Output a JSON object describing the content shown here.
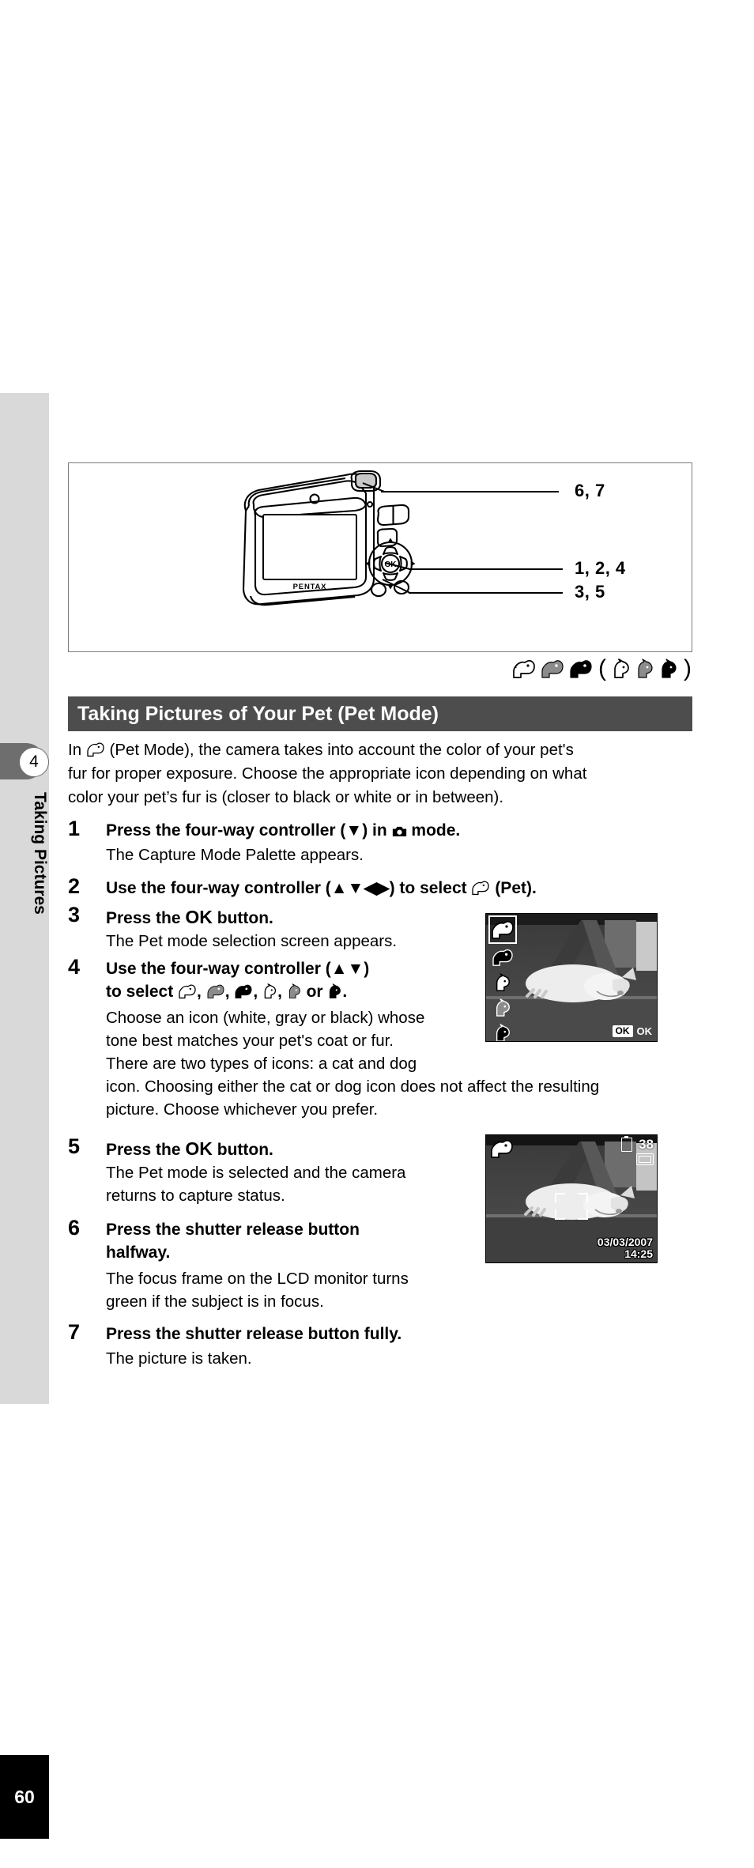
{
  "sidebar": {
    "chapter_number": "4",
    "chapter_label": "Taking Pictures",
    "page_number": "60"
  },
  "figure": {
    "camera_brand": "PENTAX",
    "callouts": [
      {
        "id": "shutter",
        "label": "6, 7"
      },
      {
        "id": "four-way-controller",
        "label": "1, 2, 4"
      },
      {
        "id": "ok-button",
        "label": "3, 5"
      }
    ]
  },
  "pet_icon_strip": {
    "dog_icons": [
      "dog-white-icon",
      "dog-gray-icon",
      "dog-black-icon"
    ],
    "open_paren": "(",
    "cat_icons": [
      "cat-white-icon",
      "cat-gray-icon",
      "cat-black-icon"
    ],
    "close_paren": ")"
  },
  "section": {
    "heading": "Taking Pictures of Your Pet (Pet Mode)"
  },
  "intro": {
    "line1_pre": "In",
    "line1_post": "(Pet Mode), the camera takes into account the color of your pet's",
    "line2": "fur for proper exposure. Choose the appropriate icon depending on what",
    "line3": "color your pet’s fur is (closer to black or white or in between)."
  },
  "steps": [
    {
      "number": "1",
      "title_a": "Press the four-way controller (",
      "title_arrow": "▼",
      "title_b": ") in",
      "title_c": "mode.",
      "body": [
        "The Capture Mode Palette appears."
      ]
    },
    {
      "number": "2",
      "title_a": "Use the four-way controller (",
      "title_arrows": "▲▼◀▶",
      "title_b": ") to select",
      "title_c": "(Pet).",
      "body": []
    },
    {
      "number": "3",
      "title_a": "Press the",
      "title_ok": "OK",
      "title_b": "button.",
      "body": [
        "The Pet mode selection screen appears."
      ]
    },
    {
      "number": "4",
      "title_a": "Use the four-way controller (",
      "title_arrows": "▲▼",
      "title_b": ")",
      "title_line2_a": "to select",
      "title_line2_or": "or",
      "title_line2_end": ".",
      "body": [
        "Choose an icon (white, gray or black) whose",
        "tone best matches your pet's coat or fur.",
        "There are two types of icons: a cat and dog",
        "icon. Choosing either the cat or dog icon does not affect the resulting",
        "picture. Choose whichever you prefer."
      ]
    },
    {
      "number": "5",
      "title_a": "Press the",
      "title_ok": "OK",
      "title_b": "button.",
      "body": [
        "The Pet mode is selected and the camera",
        "returns to capture status."
      ]
    },
    {
      "number": "6",
      "title_a": "Press the shutter release button",
      "title_line2": "halfway.",
      "body": [
        "The focus frame on the LCD monitor turns",
        "green if the subject is in focus."
      ]
    },
    {
      "number": "7",
      "title_a": "Press the shutter release button fully.",
      "body": [
        "The picture is taken."
      ]
    }
  ],
  "lcd_selection_screen": {
    "ok_solid": "OK",
    "ok_outline": "OK",
    "selector_items": [
      "dog-white-icon",
      "dog-black-icon",
      "cat-white-icon",
      "cat-gray-icon",
      "cat-black-icon"
    ]
  },
  "lcd_capture_screen": {
    "mode_icon": "dog-white-icon",
    "shots_remaining": "38",
    "battery_icon": "battery-icon",
    "card_icon": "memory-card-icon",
    "date": "03/03/2007",
    "time": "14:25"
  },
  "colors": {
    "section_bar": "#4d4d4d",
    "sidebar": "#d9d9d9",
    "chapter_tab": "#6e6e6e",
    "page_block": "#000000",
    "icon_gray": "#8c8c8c",
    "icon_black": "#000000"
  }
}
